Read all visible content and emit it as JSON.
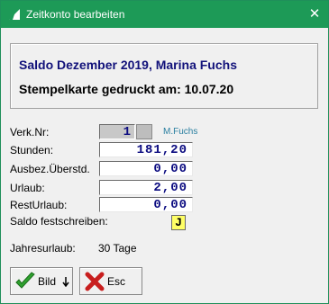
{
  "window": {
    "title": "Zeitkonto bearbeiten",
    "close_glyph": "✕"
  },
  "header": {
    "line1": "Saldo Dezember  2019, Marina Fuchs",
    "line2": "Stempelkarte gedruckt am: 10.07.20"
  },
  "form": {
    "verk_label": "Verk.Nr:",
    "verk_value": "1",
    "verk_name": "M.Fuchs",
    "stunden_label": "Stunden:",
    "stunden_value": "181,20",
    "ausbez_label": "Ausbez.Überstd.",
    "ausbez_value": "0,00",
    "urlaub_label": "Urlaub:",
    "urlaub_value": "2,00",
    "resturlaub_label": "RestUrlaub:",
    "resturlaub_value": "0,00",
    "saldo_label": "Saldo festschreiben:",
    "saldo_value": "J",
    "jahres_label": "Jahresurlaub:",
    "jahres_value": "30 Tage"
  },
  "buttons": {
    "bild_label": "Bild",
    "esc_label": "Esc"
  },
  "colors": {
    "titlebar": "#1d9a57",
    "header_text": "#11117a",
    "value_text": "#0b0b80",
    "checkbox_bg": "#ffff66"
  }
}
